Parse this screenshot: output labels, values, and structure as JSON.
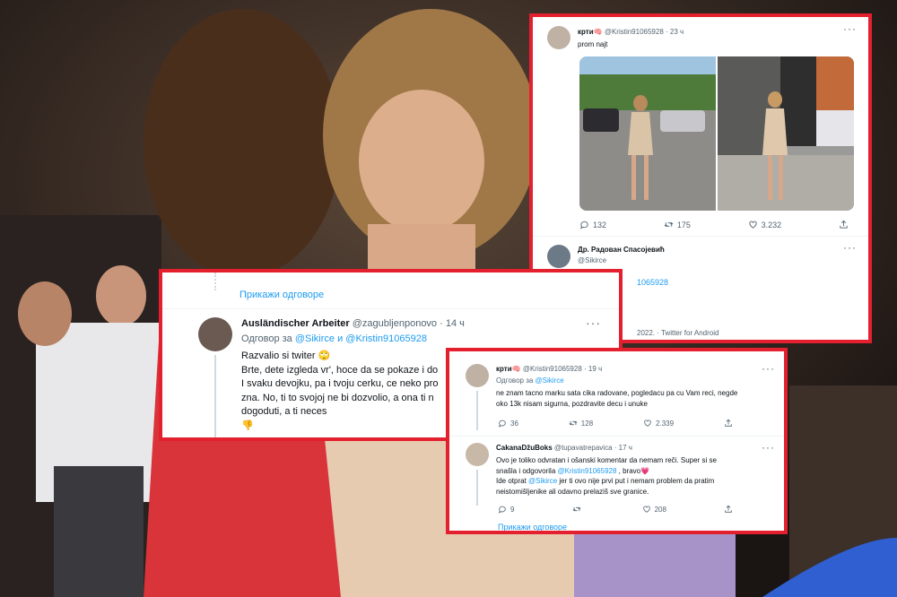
{
  "card_top": {
    "tweet": {
      "name": "крти🧠",
      "handle": "@Kristin91065928",
      "time": "· 23 ч",
      "text": "prom najt",
      "stats": {
        "replies": "132",
        "retweets": "175",
        "likes": "3.232"
      }
    },
    "reply": {
      "name": "Др. Радован Спасојевић",
      "handle": "@Sikirce",
      "mention": "1065928",
      "footer": "2022. · Twitter for Android"
    }
  },
  "card_left": {
    "show_replies": "Прикажи одговоре",
    "name": "Ausländischer Arbeiter",
    "handle": "@zagubljenponovo",
    "time": "· 14 ч",
    "reply_to_prefix": "Одговор за",
    "reply_to_users": "@Sikirce и @Kristin91065928",
    "lines": [
      "Razvalio si twiter 🙄",
      "Brte, dete izgleda vr', hoce da se pokaze i do",
      "I svaku devojku, pa i tvoju cerku, ce neko pro",
      "zna. No, ti to svojoj ne bi dozvolio, a ona ti n",
      "dogoduti, a ti neces",
      "👎"
    ]
  },
  "card_bottom": {
    "tweet1": {
      "name": "крти🧠",
      "handle": "@Kristin91065928",
      "time": "· 19 ч",
      "reply_to_prefix": "Одговор за",
      "reply_to_user": "@Sikirce",
      "lines": [
        "ne znam tacno marku sata cika radovane, pogledacu pa cu Vam reci, negde",
        "oko 13k nisam sigurna, pozdravite decu i unuke"
      ],
      "stats": {
        "replies": "36",
        "retweets": "128",
        "likes": "2.339"
      }
    },
    "tweet2": {
      "name": "CakanaDžuBoks",
      "handle": "@tupavatrepavica",
      "time": "· 17 ч",
      "line1": "Ovo je toliko odvratan i ošanski komentar da nemam reči. Super si se",
      "line2_pre": "snašla i odgovorila ",
      "line2_mention": "@Kristin91065928",
      "line2_post": " , bravo💗",
      "line3_pre": "Ide otprat ",
      "line3_mention": "@Sikirce",
      "line3_post": " jer ti ovo nije prvi put i nemam problem da pratim",
      "line4": "neistomišljenike ali odavno prelaziš sve granice.",
      "stats": {
        "replies": "9",
        "retweets": "",
        "likes": "208"
      }
    },
    "show_replies": "Прикажи одговоре"
  },
  "colors": {
    "frame": "#e4202f",
    "link": "#1d9bf0",
    "muted": "#536471"
  },
  "icons": [
    "reply-icon",
    "retweet-icon",
    "like-icon",
    "share-icon",
    "more-icon"
  ]
}
